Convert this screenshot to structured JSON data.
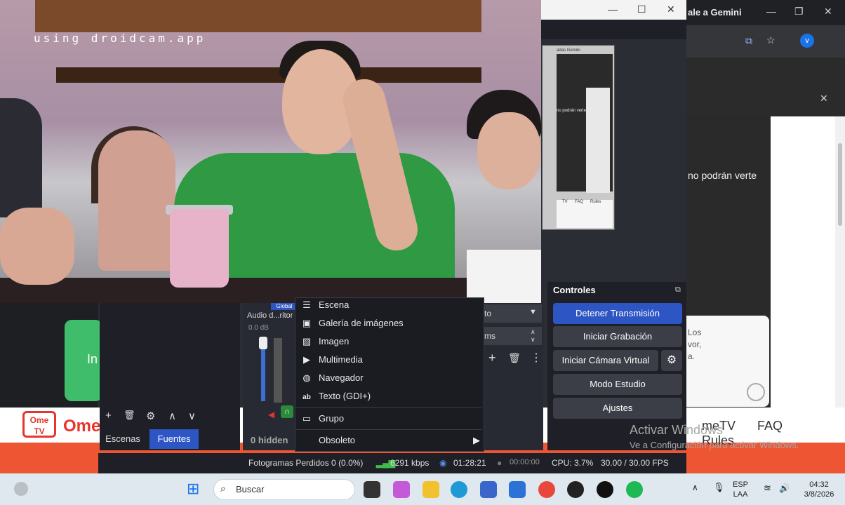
{
  "webcam": {
    "watermark": "using droidcam.app"
  },
  "browser": {
    "tab_title": "ale a Gemini",
    "overlay_text": "no podrán verte",
    "card_lines": [
      "Los",
      "vor,",
      "a."
    ],
    "green_button_letter": "In",
    "footer_links": [
      "meTV",
      "FAQ",
      "Rules"
    ],
    "brand": "Ome",
    "logo_line1": "Ome",
    "logo_line2": "TV"
  },
  "nested_preview": {
    "labels": [
      "adas Gemini",
      "no podrán verte",
      "TV",
      "FAQ",
      "Rules"
    ]
  },
  "obs": {
    "audio": {
      "badge": "Global",
      "name": "Audio d...ritor",
      "level": "0.0 dB"
    },
    "mid_fragments": [
      "to",
      "ms"
    ],
    "scenes_tabs": [
      "Escenas",
      "Fuentes"
    ],
    "hidden": "0 hidden",
    "controls": {
      "title": "Controles",
      "buttons": [
        "Detener Transmisión",
        "Iniciar Grabación",
        "Iniciar Cámara Virtual",
        "Modo Estudio",
        "Ajustes"
      ]
    },
    "context_menu": [
      {
        "label": "Escena",
        "icon": "list-icon"
      },
      {
        "label": "Galería de imágenes",
        "icon": "slideshow-icon"
      },
      {
        "label": "Imagen",
        "icon": "image-icon"
      },
      {
        "label": "Multimedia",
        "icon": "play-icon"
      },
      {
        "label": "Navegador",
        "icon": "globe-icon"
      },
      {
        "label": "Texto (GDI+)",
        "icon": "text-icon"
      },
      {
        "label": "Grupo",
        "icon": "folder-icon"
      },
      {
        "label": "Obsoleto",
        "icon": "submenu-arrow-icon"
      }
    ],
    "status": {
      "dropped": "Fotogramas Perdidos 0 (0.0%)",
      "bitrate": "6291 kbps",
      "stream_time": "01:28:21",
      "record_time": "00:00:00",
      "cpu": "CPU: 3.7%",
      "fps": "30.00 / 30.00 FPS"
    }
  },
  "windows": {
    "activation_title": "Activar Windows",
    "activation_sub": "Ve a Configuración para activar Windows."
  },
  "taskbar": {
    "search_placeholder": "Buscar",
    "lang1": "ESP",
    "lang2": "LAA",
    "time": "04:32",
    "date": "3/8/2026"
  }
}
